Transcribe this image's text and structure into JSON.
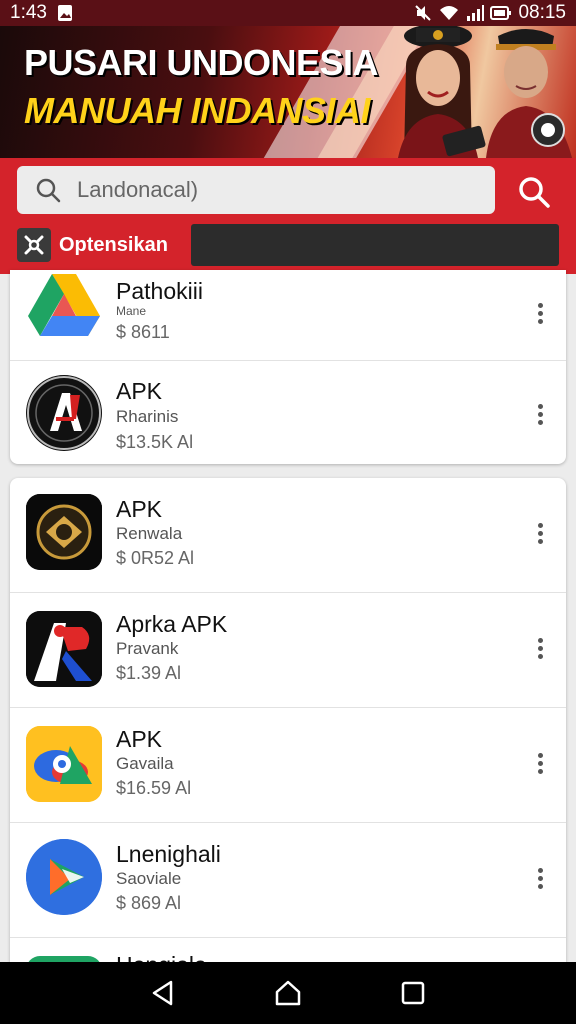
{
  "status_bar": {
    "time": "1:43",
    "clock": "08:15"
  },
  "banner": {
    "title_line1": "PUSARI UNDONESIA",
    "title_line2": "MANUAH INDANSIAI"
  },
  "search": {
    "value": "Landonacal)"
  },
  "filter": {
    "label": "Optensikan"
  },
  "apps": [
    {
      "name": "Pathokiii",
      "subtitle": "Mane",
      "price": "$ 8611",
      "icon": "google-drive-icon"
    },
    {
      "name": "APK",
      "subtitle": "Rharinis",
      "price": "$13.5K Al",
      "icon": "apk-a-logo-icon"
    },
    {
      "name": "APK",
      "subtitle": "Renwala",
      "price": "$ 0R52 Al",
      "icon": "gold-emblem-icon"
    },
    {
      "name": "Aprka APK",
      "subtitle": "Pravank",
      "price": "$1.39  Al",
      "icon": "apk-ap-logo-icon"
    },
    {
      "name": "APK",
      "subtitle": "Gavaila",
      "price": "$16.59 Al",
      "icon": "map-pin-icon"
    },
    {
      "name": "Lnenighali",
      "subtitle": "Saoviale",
      "price": "$ 869 Al",
      "icon": "play-arrow-icon"
    },
    {
      "name": "Hengiala",
      "subtitle": "",
      "price": "",
      "icon": "green-app-icon"
    }
  ],
  "colors": {
    "brand_red": "#d4232b",
    "status_bar": "#5a1016",
    "banner_yellow": "#ffd21a"
  }
}
